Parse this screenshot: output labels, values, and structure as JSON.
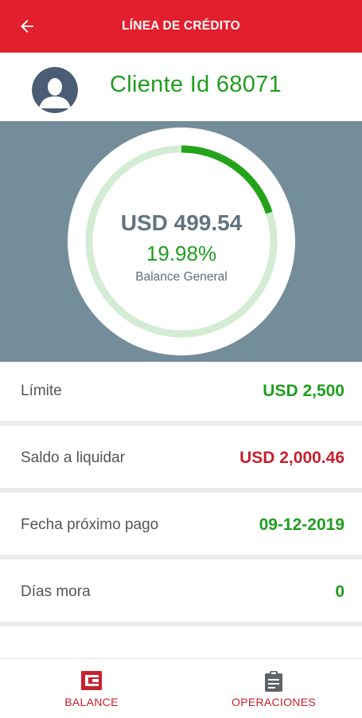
{
  "appbar": {
    "title": "LÍNEA DE CRÉDITO"
  },
  "client": {
    "name": "Cliente Id 68071"
  },
  "balance": {
    "amount": "USD 499.54",
    "percent_text": "19.98%",
    "label": "Balance General",
    "progress_fraction": 0.1998
  },
  "rows": [
    {
      "label": "Límite",
      "value": "USD 2,500"
    },
    {
      "label": "Saldo a liquidar",
      "value": "USD 2,000.46"
    },
    {
      "label": "Fecha próximo pago",
      "value": "09-12-2019"
    },
    {
      "label": "Días mora",
      "value": "0"
    }
  ],
  "nav": [
    {
      "label": "BALANCE",
      "icon": "card-icon"
    },
    {
      "label": "OPERACIONES",
      "icon": "clipboard-icon"
    }
  ],
  "colors": {
    "brand": "#e31e2d",
    "positive": "#1f9e1f",
    "negative": "#c8202d",
    "hero_bg": "#748d9a"
  }
}
